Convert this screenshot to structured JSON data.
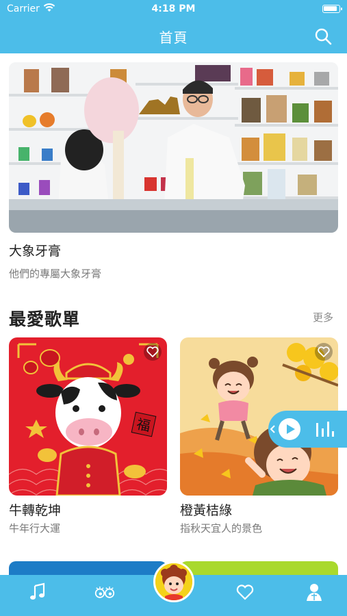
{
  "status": {
    "carrier": "Carrier",
    "time": "4:18 PM"
  },
  "nav": {
    "title": "首頁",
    "search_icon": "search-icon"
  },
  "featured": {
    "title": "大象牙膏",
    "subtitle": "他們的專屬大象牙膏"
  },
  "playlists": {
    "title": "最愛歌單",
    "more": "更多",
    "items": [
      {
        "title": "牛轉乾坤",
        "subtitle": "牛年行大運",
        "badge": "福"
      },
      {
        "title": "橙黃桔綠",
        "subtitle": "指秋天宜人的景色"
      }
    ]
  },
  "tabs": [
    "music-note-icon",
    "eyes-icon",
    "avatar",
    "heart-icon",
    "profile-icon"
  ],
  "colors": {
    "brand": "#4cbde9",
    "accent": "#f4d21a",
    "red": "#e31f2c"
  }
}
